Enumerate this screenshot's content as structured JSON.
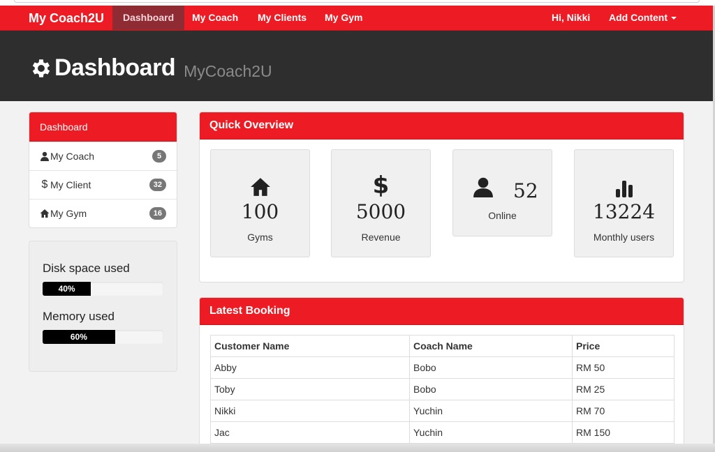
{
  "navbar": {
    "brand": "My Coach2U",
    "items": [
      {
        "label": "Dashboard",
        "active": true
      },
      {
        "label": "My Coach"
      },
      {
        "label": "My Clients"
      },
      {
        "label": "My Gym"
      }
    ],
    "greeting": "Hi, Nikki",
    "add_content": "Add Content"
  },
  "hero": {
    "icon": "gear-icon",
    "title": "Dashboard",
    "subtitle": "MyCoach2U"
  },
  "sidebar": {
    "heading": "Dashboard",
    "items": [
      {
        "label": "My Coach",
        "count": "5",
        "icon": "user-icon"
      },
      {
        "label": "My Client",
        "count": "32",
        "icon": "dollar-icon"
      },
      {
        "label": "My Gym",
        "count": "16",
        "icon": "home-icon"
      }
    ]
  },
  "usage": {
    "disk_label": "Disk space used",
    "disk_value": "40%",
    "disk_fraction": 0.4,
    "memory_label": "Memory used",
    "memory_value": "60%",
    "memory_fraction": 0.6
  },
  "overview": {
    "heading": "Quick Overview",
    "stats": [
      {
        "icon": "home-icon",
        "value": "100",
        "label": "Gyms"
      },
      {
        "icon": "dollar-icon",
        "value": "5000",
        "label": "Revenue"
      },
      {
        "icon": "user-icon",
        "value": "52",
        "label": "Online"
      },
      {
        "icon": "bar-chart-icon",
        "value": "13224",
        "label": "Monthly users"
      }
    ]
  },
  "bookings": {
    "heading": "Latest Booking",
    "columns": [
      "Customer Name",
      "Coach Name",
      "Price"
    ],
    "rows": [
      [
        "Abby",
        "Bobo",
        "RM 50"
      ],
      [
        "Toby",
        "Bobo",
        "RM 25"
      ],
      [
        "Nikki",
        "Yuchin",
        "RM 70"
      ],
      [
        "Jac",
        "Yuchin",
        "RM 150"
      ]
    ]
  },
  "colors": {
    "brand_red": "#ed1c24",
    "hero_dark": "#2e2e2e",
    "active_nav": "#8f2b33"
  }
}
